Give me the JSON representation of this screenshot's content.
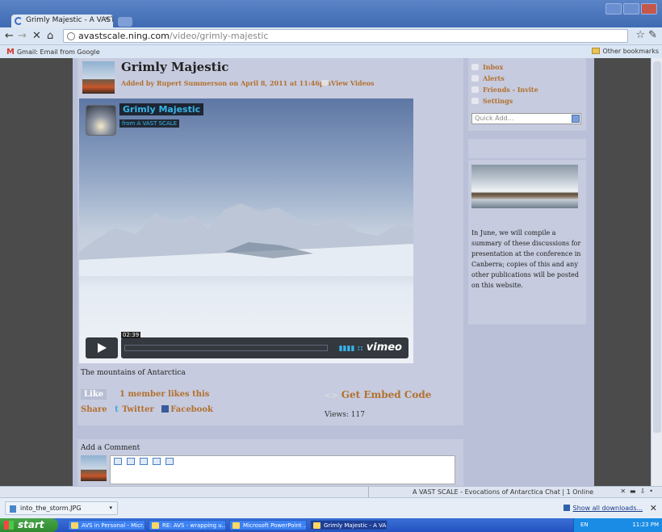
{
  "browser": {
    "tab_title": "Grimly Majestic - A VAST SCAL",
    "url_host": "avastscale.ning.com",
    "url_path": "/video/grimly-majestic",
    "bookmark_gmail": "Gmail: Email from Google",
    "bookmark_other": "Other bookmarks"
  },
  "video_page": {
    "title": "Grimly Majestic",
    "added_by": "Added by Rupert Summerson on April 8, 2011 at 11:46pm",
    "view_videos": "View Videos",
    "player": {
      "name": "Grimly Majestic",
      "from_label": "from",
      "from_channel": "A VAST SCALE",
      "time": "02:39",
      "brand": "vimeo"
    },
    "caption": "The mountains of Antarctica",
    "like_label": "Like",
    "like_count": "1 member likes this",
    "share_label": "Share",
    "twitter_label": "Twitter",
    "facebook_label": "Facebook",
    "embed_label": "Get Embed Code",
    "views": "Views: 117"
  },
  "comments": {
    "header": "Add a Comment"
  },
  "sidebar": {
    "links": [
      "Inbox",
      "Alerts",
      "Friends - Invite",
      "Settings"
    ],
    "quick_add": "Quick Add...",
    "text": "In June, we will compile a summary of these discussions for presentation at the conference in Canberra; copies of this and any other publications will be posted on this website."
  },
  "status": {
    "chat": "A VAST SCALE - Evocations of Antarctica Chat | 1 Online"
  },
  "downloads": {
    "file": "into_the_storm.JPG",
    "show_all": "Show all downloads..."
  },
  "taskbar": {
    "start": "start",
    "items": [
      "AVS in Personal - Micr...",
      "RE: AVS - wrapping u...",
      "Microsoft PowerPoint ...",
      "Grimly Majestic - A VA..."
    ],
    "clock": "11:23 PM",
    "lang": "EN"
  },
  "colors": {
    "link": "#b3702e",
    "vimeo_blue": "#36b4e8",
    "panel": "#c6cbdf"
  }
}
